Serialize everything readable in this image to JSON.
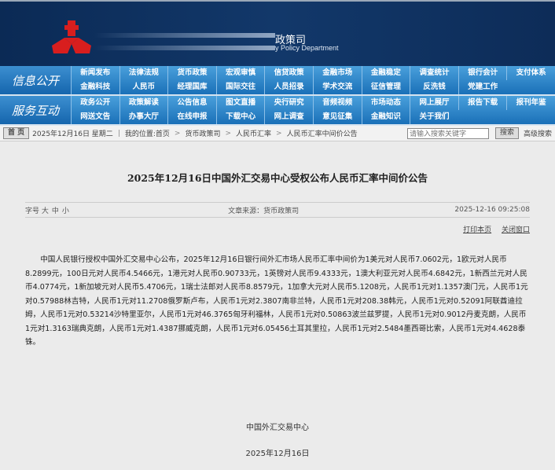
{
  "header": {
    "title_partial": "政策司",
    "subtitle_partial": "y Policy Department"
  },
  "nav": {
    "sections": [
      {
        "label": "信息公开",
        "items": [
          "新闻发布",
          "法律法规",
          "货币政策",
          "宏观审慎",
          "信贷政策",
          "金融市场",
          "金融稳定",
          "调查统计",
          "银行会计",
          "支付体系",
          "金融科技",
          "人民币",
          "经理国库",
          "国际交往",
          "人员招录",
          "学术交流",
          "征信管理",
          "反洗钱",
          "党建工作"
        ]
      },
      {
        "label": "服务互动",
        "items": [
          "政务公开",
          "政策解读",
          "公告信息",
          "图文直播",
          "央行研究",
          "音频视频",
          "市场动态",
          "网上展厅",
          "报告下载",
          "报刊年鉴",
          "网送文告",
          "办事大厅",
          "在线申报",
          "下载中心",
          "网上调查",
          "意见征集",
          "金融知识",
          "关于我们"
        ]
      }
    ]
  },
  "breadcrumb": {
    "home": "首 页",
    "date": "2025年12月16日 星期二",
    "location_label": "我的位置:",
    "path": [
      "首页",
      "货币政策司",
      "人民币汇率",
      "人民币汇率中间价公告"
    ],
    "search_placeholder": "请输入搜索关键字",
    "search_button": "搜索",
    "advanced_search": "高级搜索"
  },
  "article": {
    "title": "2025年12月16日中国外汇交易中心受权公布人民币汇率中间价公告",
    "font_size_label": "字号",
    "font_sizes": [
      "大",
      "中",
      "小"
    ],
    "source": "文章来源：货币政策司",
    "timestamp": "2025-12-16 09:25:08",
    "print": "打印本页",
    "close": "关闭窗口",
    "body": "中国人民银行授权中国外汇交易中心公布，2025年12月16日银行间外汇市场人民币汇率中间价为1美元对人民币7.0602元，1欧元对人民币8.2899元，100日元对人民币4.5466元，1港元对人民币0.90733元，1英镑对人民币9.4333元，1澳大利亚元对人民币4.6842元，1新西兰元对人民币4.0774元，1新加坡元对人民币5.4706元，1瑞士法郎对人民币8.8579元，1加拿大元对人民币5.1208元，人民币1元对1.1357澳门元，人民币1元对0.57988林吉特，人民币1元对11.2708俄罗斯卢布，人民币1元对2.3807南非兰特，人民币1元对208.38韩元，人民币1元对0.52091阿联酋迪拉姆，人民币1元对0.53214沙特里亚尔，人民币1元对46.3765匈牙利福林，人民币1元对0.50863波兰兹罗提，人民币1元对0.9012丹麦克朗，人民币1元对1.3163瑞典克朗，人民币1元对1.4387挪威克朗，人民币1元对6.05456土耳其里拉，人民币1元对2.5484墨西哥比索，人民币1元对4.4628泰铢。",
    "signature": "中国外汇交易中心",
    "date": "2025年12月16日"
  }
}
